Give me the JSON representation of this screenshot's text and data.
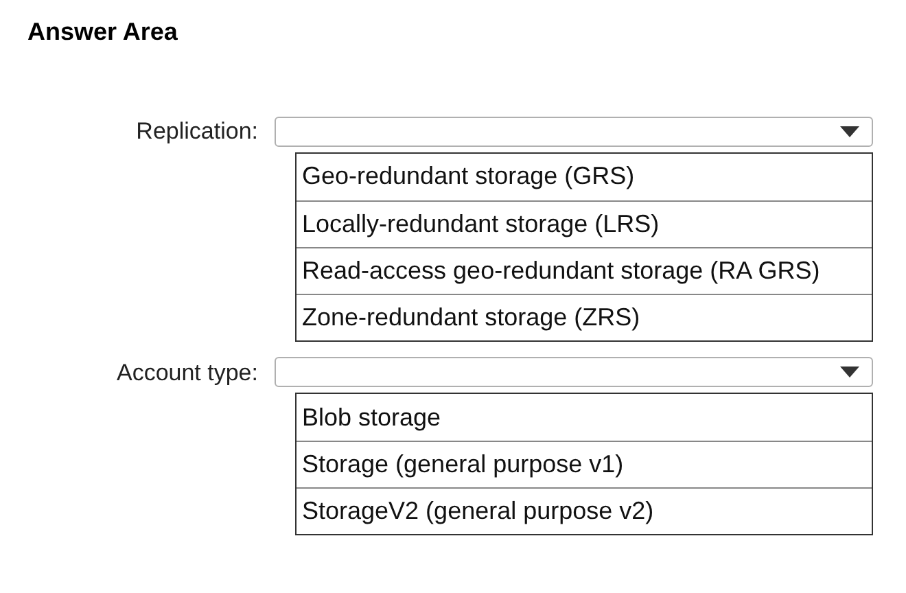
{
  "title": "Answer Area",
  "questions": [
    {
      "label": "Replication:",
      "options": [
        "Geo-redundant storage (GRS)",
        "Locally-redundant storage (LRS)",
        "Read-access geo-redundant storage (RA GRS)",
        "Zone-redundant storage (ZRS)"
      ]
    },
    {
      "label": "Account type:",
      "options": [
        "Blob storage",
        "Storage (general purpose v1)",
        "StorageV2 (general purpose v2)"
      ]
    }
  ]
}
